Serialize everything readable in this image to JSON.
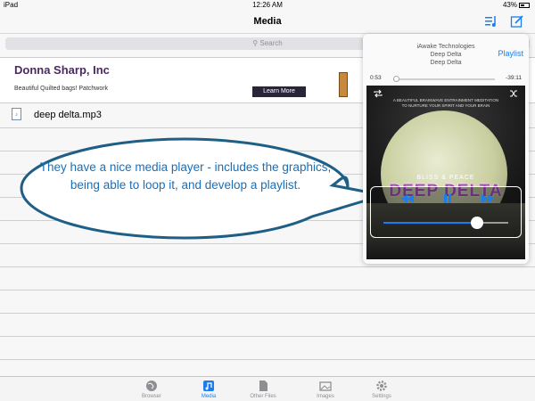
{
  "status_bar": {
    "carrier": "iPad",
    "time": "12:26 AM",
    "battery": "43%"
  },
  "nav": {
    "title": "Media"
  },
  "search": {
    "placeholder": "Search"
  },
  "ad": {
    "name": "Donna Sharp, Inc",
    "tagline": "Beautiful Quilted bags! Patchwork",
    "button": "Learn More"
  },
  "files": [
    {
      "name": "deep delta.mp3",
      "icon": "mp3-file-icon"
    }
  ],
  "callout": {
    "text": "They have a nice media player - includes the graphics, being able to loop it, and develop a playlist."
  },
  "player": {
    "artist": "iAwake Technologies",
    "album": "Deep Delta",
    "track": "Deep Delta",
    "playlist_label": "Playlist",
    "elapsed": "0:53",
    "remaining": "-39:11",
    "progress_fraction": 0.03,
    "volume_fraction": 0.75,
    "art": {
      "top_text_1": "A BEAUTIFUL BRAINWAVE ENTRAINMENT MEDITATION",
      "top_text_2": "TO NURTURE YOUR SPIRIT AND YOUR BRAIN",
      "subtitle": "BLISS & PEACE",
      "title": "DEEP DELTA"
    }
  },
  "tabs": [
    {
      "label": "Browser",
      "icon": "globe-icon",
      "active": false
    },
    {
      "label": "Media",
      "icon": "music-note-icon",
      "active": true
    },
    {
      "label": "Other Files",
      "icon": "document-icon",
      "active": false
    },
    {
      "label": "Images",
      "icon": "photo-icon",
      "active": false
    },
    {
      "label": "Settings",
      "icon": "gear-icon",
      "active": false
    }
  ],
  "colors": {
    "accent": "#1a7ef0",
    "callout": "#1a6fb8",
    "brand_purple": "#4a2a60"
  }
}
